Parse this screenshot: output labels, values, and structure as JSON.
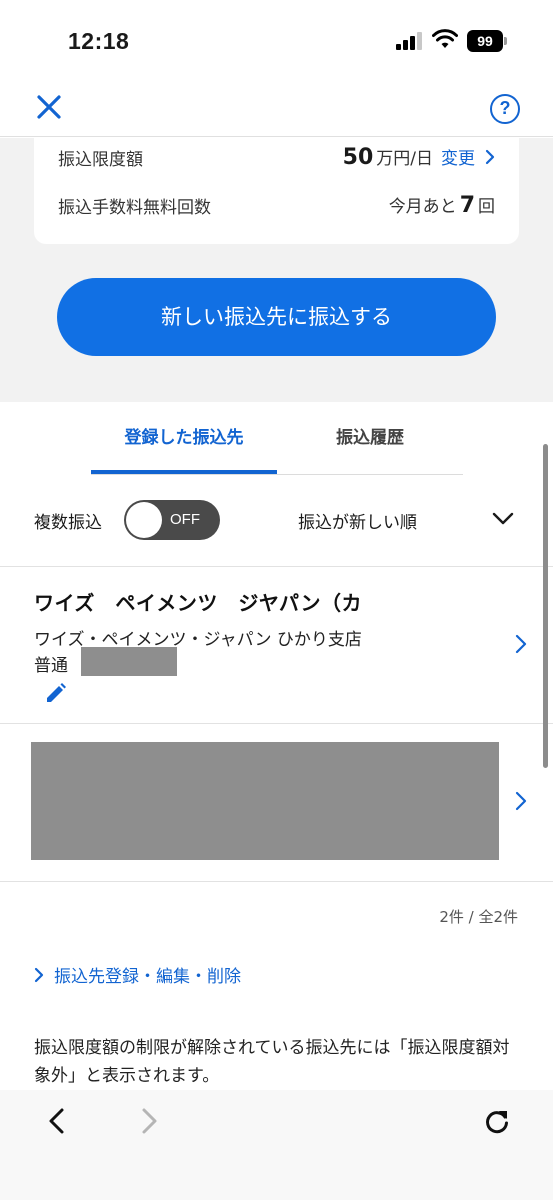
{
  "status_bar": {
    "time": "12:18",
    "battery": "99",
    "icons": [
      "signal-icon",
      "wifi-icon",
      "battery-icon"
    ]
  },
  "header": {
    "close_icon": "close-icon",
    "help_label": "?"
  },
  "limits": {
    "daily_limit_label": "振込限度額",
    "daily_limit_amount": "50",
    "daily_limit_unit": "万円/日",
    "change_label": "変更",
    "free_fee_label": "振込手数料無料回数",
    "free_fee_prefix": "今月あと",
    "free_fee_count": "7",
    "free_fee_unit": "回"
  },
  "new_transfer_button": "新しい振込先に振込する",
  "tabs": [
    {
      "label": "登録した振込先",
      "active": true
    },
    {
      "label": "振込履歴",
      "active": false
    }
  ],
  "controls": {
    "multi_transfer_label": "複数振込",
    "toggle_state": "OFF",
    "sort_label": "振込が新しい順"
  },
  "payees": [
    {
      "name": "ワイズ　ペイメンツ　ジヤパン（カ",
      "bank": "ワイズ・ペイメンツ・ジャパン ひかり支店",
      "account_type": "普通"
    }
  ],
  "count": "2件 / 全2件",
  "edit_link": "振込先登録・編集・削除",
  "note": "振込限度額の制限が解除されている振込先には「振込限度額対象外」と表示されます。",
  "colors": {
    "accent": "#1264d1",
    "button": "#1170e4",
    "toggle_off": "#4a4a4a",
    "redaction": "#8e8e8e"
  }
}
